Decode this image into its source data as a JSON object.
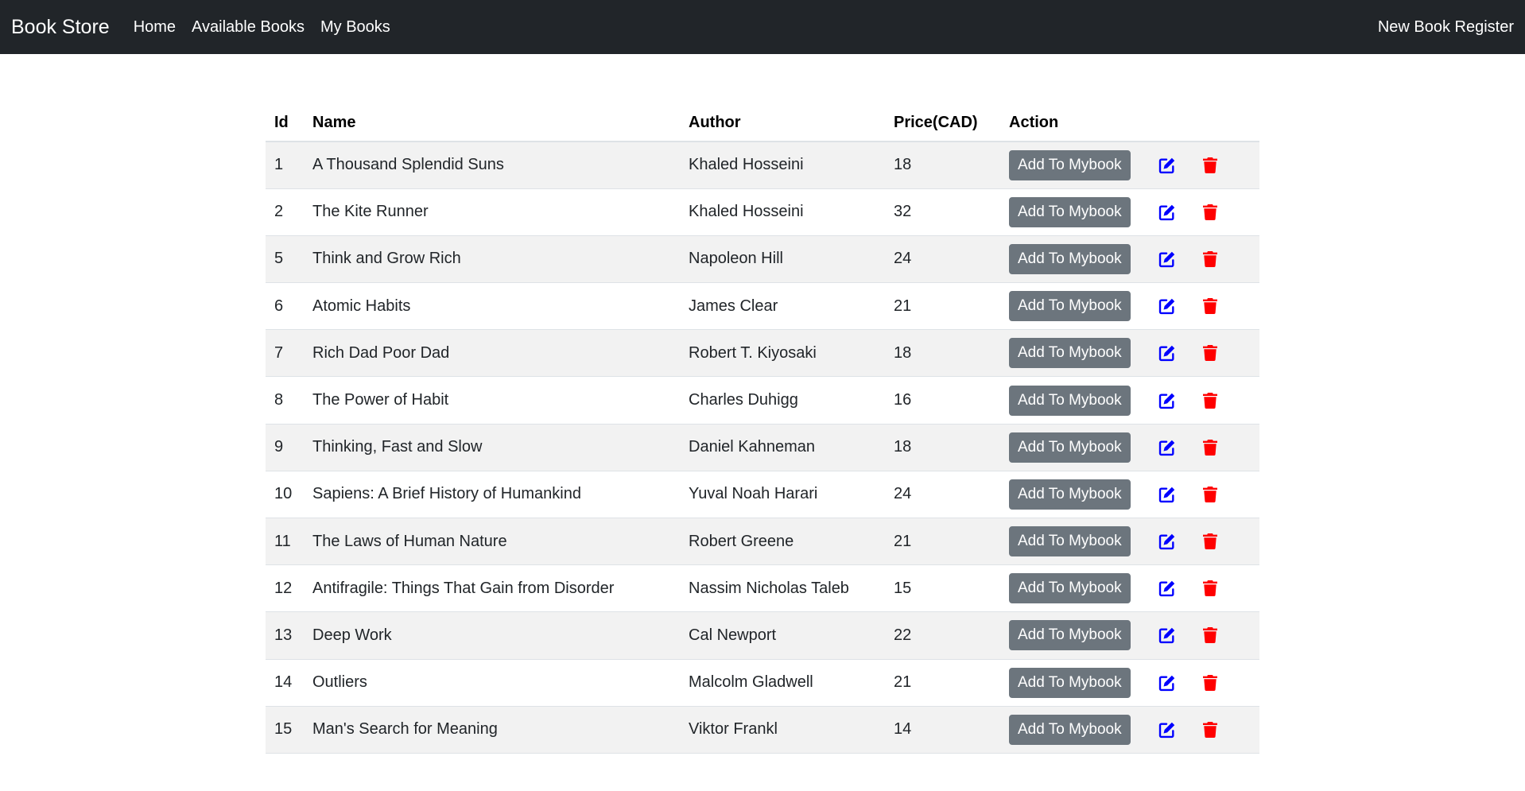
{
  "navbar": {
    "brand": "Book Store",
    "links": [
      "Home",
      "Available Books",
      "My Books"
    ],
    "right_link": "New Book Register"
  },
  "table": {
    "headers": {
      "id": "Id",
      "name": "Name",
      "author": "Author",
      "price": "Price(CAD)",
      "action": "Action"
    },
    "add_button_label": "Add To Mybook",
    "rows": [
      {
        "id": "1",
        "name": "A Thousand Splendid Suns",
        "author": "Khaled Hosseini",
        "price": "18"
      },
      {
        "id": "2",
        "name": "The Kite Runner",
        "author": "Khaled Hosseini",
        "price": "32"
      },
      {
        "id": "5",
        "name": "Think and Grow Rich",
        "author": "Napoleon Hill",
        "price": "24"
      },
      {
        "id": "6",
        "name": "Atomic Habits",
        "author": "James Clear",
        "price": "21"
      },
      {
        "id": "7",
        "name": "Rich Dad Poor Dad",
        "author": "Robert T. Kiyosaki",
        "price": "18"
      },
      {
        "id": "8",
        "name": "The Power of Habit",
        "author": "Charles Duhigg",
        "price": "16"
      },
      {
        "id": "9",
        "name": "Thinking, Fast and Slow",
        "author": "Daniel Kahneman",
        "price": "18"
      },
      {
        "id": "10",
        "name": "Sapiens: A Brief History of Humankind",
        "author": "Yuval Noah Harari",
        "price": "24"
      },
      {
        "id": "11",
        "name": "The Laws of Human Nature",
        "author": "Robert Greene",
        "price": "21"
      },
      {
        "id": "12",
        "name": "Antifragile: Things That Gain from Disorder",
        "author": "Nassim Nicholas Taleb",
        "price": "15"
      },
      {
        "id": "13",
        "name": "Deep Work",
        "author": "Cal Newport",
        "price": "22"
      },
      {
        "id": "14",
        "name": "Outliers",
        "author": "Malcolm Gladwell",
        "price": "21"
      },
      {
        "id": "15",
        "name": "Man's Search for Meaning",
        "author": "Viktor Frankl",
        "price": "14"
      }
    ]
  },
  "icons": {
    "edit": "edit-icon",
    "delete": "trash-icon"
  },
  "colors": {
    "navbar_bg": "#212529",
    "button_bg": "#6c757d",
    "edit_icon": "#0000ff",
    "delete_icon": "#ff0000",
    "striped_row": "#f2f2f2"
  }
}
